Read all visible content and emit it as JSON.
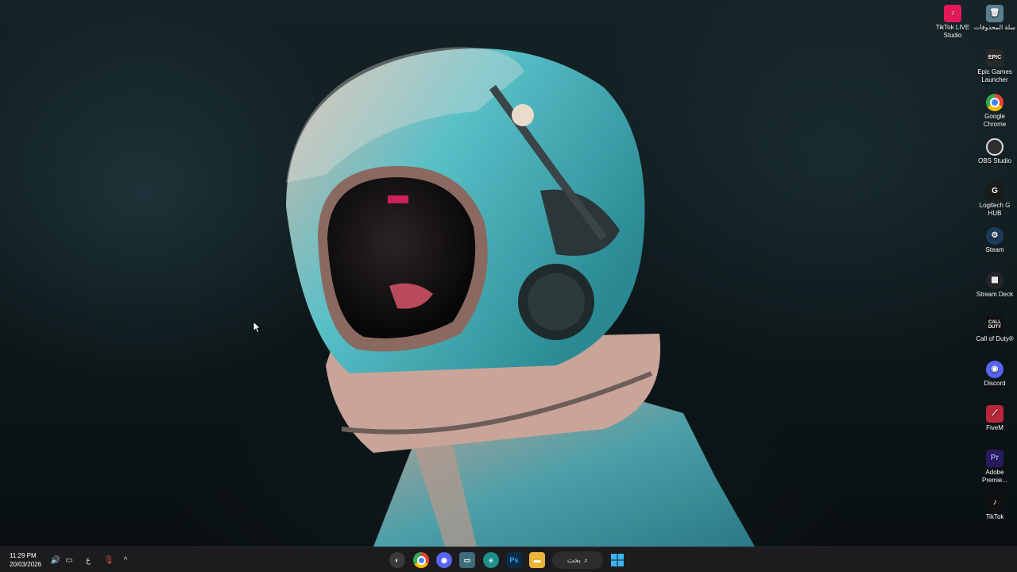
{
  "desktop_icons": [
    {
      "id": "tiktok-live",
      "label": "TikTok LIVE Studio",
      "icon": "tiktok-live-icon",
      "color": "#e6185a"
    },
    {
      "id": "recycle-bin",
      "label": "سلة المحذوفات",
      "icon": "recycle-bin-icon",
      "color": "#9fc4d6"
    },
    {
      "id": "epic",
      "label": "Epic Games Launcher",
      "icon": "epic-games-icon",
      "color": "#2a2a2a"
    },
    {
      "id": "chrome",
      "label": "Google Chrome",
      "icon": "chrome-icon",
      "color": "#4285f4"
    },
    {
      "id": "obs",
      "label": "OBS Studio",
      "icon": "obs-icon",
      "color": "#302e31"
    },
    {
      "id": "logitech",
      "label": "Logitech G HUB",
      "icon": "logitech-icon",
      "color": "#1a1a1a"
    },
    {
      "id": "steam",
      "label": "Steam",
      "icon": "steam-icon",
      "color": "#1b3a5c"
    },
    {
      "id": "streamdeck",
      "label": "Stream Deck",
      "icon": "stream-deck-icon",
      "color": "#26262a"
    },
    {
      "id": "cod",
      "label": "Call of Duty®",
      "icon": "call-of-duty-icon",
      "color": "#111111"
    },
    {
      "id": "discord",
      "label": "Discord",
      "icon": "discord-icon",
      "color": "#5865f2"
    },
    {
      "id": "fivem",
      "label": "FiveM",
      "icon": "fivem-icon",
      "color": "#b8263a"
    },
    {
      "id": "premiere",
      "label": "Adobe Premie...",
      "icon": "premiere-icon",
      "color": "#2a1a5e"
    },
    {
      "id": "tiktok",
      "label": "TikTok",
      "icon": "tiktok-icon",
      "color": "#111111"
    }
  ],
  "taskbar": {
    "time": "11:29 PM",
    "date": "20/03/2026",
    "language": "ع",
    "search_label": "بحث",
    "apps": [
      {
        "id": "obs",
        "icon": "obs-icon",
        "color": "#3a3a3c"
      },
      {
        "id": "chrome",
        "icon": "chrome-icon",
        "color": "#4285f4"
      },
      {
        "id": "discord",
        "icon": "discord-icon",
        "color": "#5865f2"
      },
      {
        "id": "monitor",
        "icon": "monitor-app-icon",
        "color": "#3d6b7a"
      },
      {
        "id": "edge",
        "icon": "edge-icon",
        "color": "#1f8f8a"
      },
      {
        "id": "photoshop",
        "icon": "photoshop-icon",
        "color": "#0b2a44",
        "text": "Ps"
      },
      {
        "id": "explorer",
        "icon": "file-explorer-icon",
        "color": "#e8b43a"
      }
    ]
  }
}
